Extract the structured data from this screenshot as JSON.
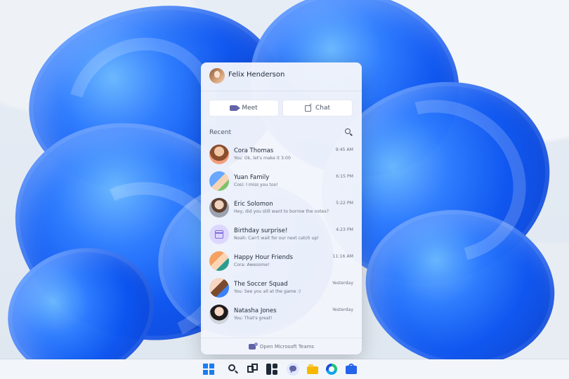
{
  "panel": {
    "user": {
      "name": "Felix Henderson"
    },
    "actions": {
      "meet_label": "Meet",
      "chat_label": "Chat"
    },
    "recent_label": "Recent",
    "footer_label": "Open Microsoft Teams",
    "conversations": [
      {
        "name": "Cora Thomas",
        "preview": "You: Ok, let's make it 3:00",
        "time": "9:45 AM",
        "avatar_icon": "avatar"
      },
      {
        "name": "Yuan Family",
        "preview": "Cosi: I miss you too!",
        "time": "6:15 PM",
        "avatar_icon": "avatar"
      },
      {
        "name": "Eric Solomon",
        "preview": "Hey, did you still want to borrow the notes?",
        "time": "5:22 PM",
        "avatar_icon": "avatar"
      },
      {
        "name": "Birthday surprise!",
        "preview": "Noah: Can't wait for our next catch up!",
        "time": "4:23 PM",
        "avatar_icon": "calendar-icon"
      },
      {
        "name": "Happy Hour Friends",
        "preview": "Cora: Awesome!",
        "time": "11:16 AM",
        "avatar_icon": "avatar"
      },
      {
        "name": "The Soccer Squad",
        "preview": "You: See you all at the game :)",
        "time": "Yesterday",
        "avatar_icon": "avatar"
      },
      {
        "name": "Natasha Jones",
        "preview": "You: That's great!",
        "time": "Yesterday",
        "avatar_icon": "avatar"
      }
    ]
  },
  "taskbar": {
    "icons": [
      "windows-icon",
      "search-icon",
      "task-view-icon",
      "widgets-icon",
      "chat-icon",
      "folder-icon",
      "edge-icon",
      "store-icon"
    ]
  }
}
